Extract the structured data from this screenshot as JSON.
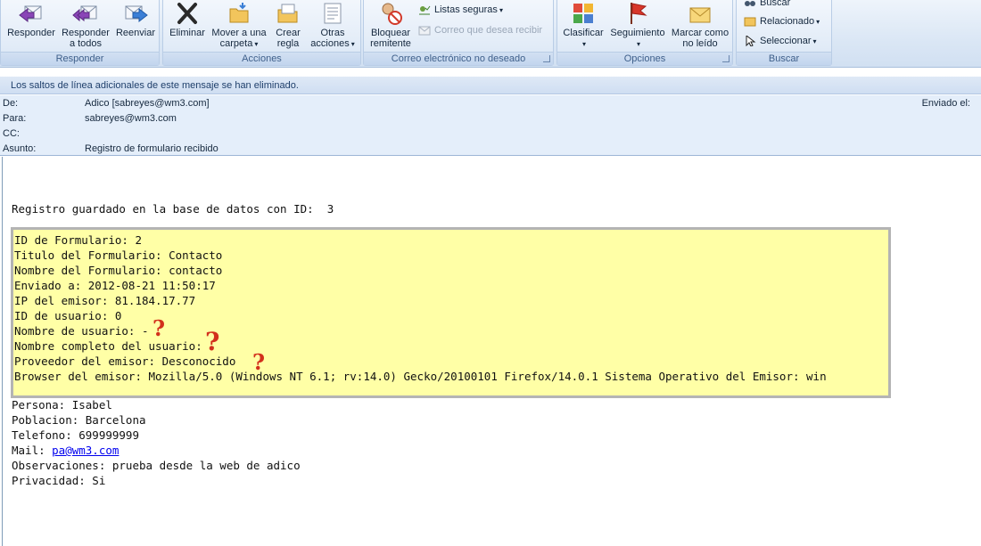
{
  "ribbon": {
    "groups": {
      "responder": "Responder",
      "acciones": "Acciones",
      "correo_no_deseado": "Correo electrónico no deseado",
      "opciones": "Opciones",
      "buscar": "Buscar"
    },
    "buttons": {
      "responder": [
        "Responder"
      ],
      "responder_todos": [
        "Responder",
        "a todos"
      ],
      "reenviar": [
        "Reenviar"
      ],
      "eliminar": [
        "Eliminar"
      ],
      "mover": [
        "Mover a una",
        "carpeta"
      ],
      "crear_regla": [
        "Crear",
        "regla"
      ],
      "otras_acciones": [
        "Otras",
        "acciones"
      ],
      "bloquear": [
        "Bloquear",
        "remitente"
      ],
      "listas_seguras": "Listas seguras",
      "correo_que_desea": "Correo que desea recibir",
      "clasificar": [
        "Clasificar"
      ],
      "seguimiento": [
        "Seguimiento"
      ],
      "marcar": [
        "Marcar como",
        "no leído"
      ],
      "buscar": "Buscar",
      "relacionado": "Relacionado",
      "seleccionar": "Seleccionar"
    }
  },
  "infobar": "Los saltos de línea adicionales de este mensaje se han eliminado.",
  "header": {
    "de_label": "De:",
    "de_value": "Adico [sabreyes@wm3.com]",
    "para_label": "Para:",
    "para_value": "sabreyes@wm3.com",
    "cc_label": "CC:",
    "cc_value": "",
    "asunto_label": "Asunto:",
    "asunto_value": "Registro de formulario recibido",
    "enviado_label": "Enviado el:"
  },
  "body": {
    "registro": "Registro guardado en la base de datos con ID:  3",
    "box_lines": [
      "ID de Formulario: 2",
      "Titulo del Formulario: Contacto",
      "Nombre del Formulario: contacto",
      "Enviado a: 2012-08-21 11:50:17",
      "IP del emisor: 81.184.17.77",
      "ID de usuario: 0",
      "Nombre de usuario: -",
      "Nombre completo del usuario: -",
      "Proveedor del emisor: Desconocido",
      "Browser del emisor: Mozilla/5.0 (Windows NT 6.1; rv:14.0) Gecko/20100101 Firefox/14.0.1 Sistema Operativo del Emisor: win"
    ],
    "persona": "Persona: Isabel",
    "poblacion": "Poblacion: Barcelona",
    "telefono": "Telefono: 699999999",
    "mail_label": "Mail: ",
    "mail_link": "pa@wm3.com",
    "observaciones": "Observaciones: prueba desde la web de adico",
    "privacidad": "Privacidad: Si",
    "question_mark": "?"
  },
  "colors": {
    "highlight": "#ffffa6",
    "annotation": "#d2301c",
    "link": "#0000ee"
  }
}
